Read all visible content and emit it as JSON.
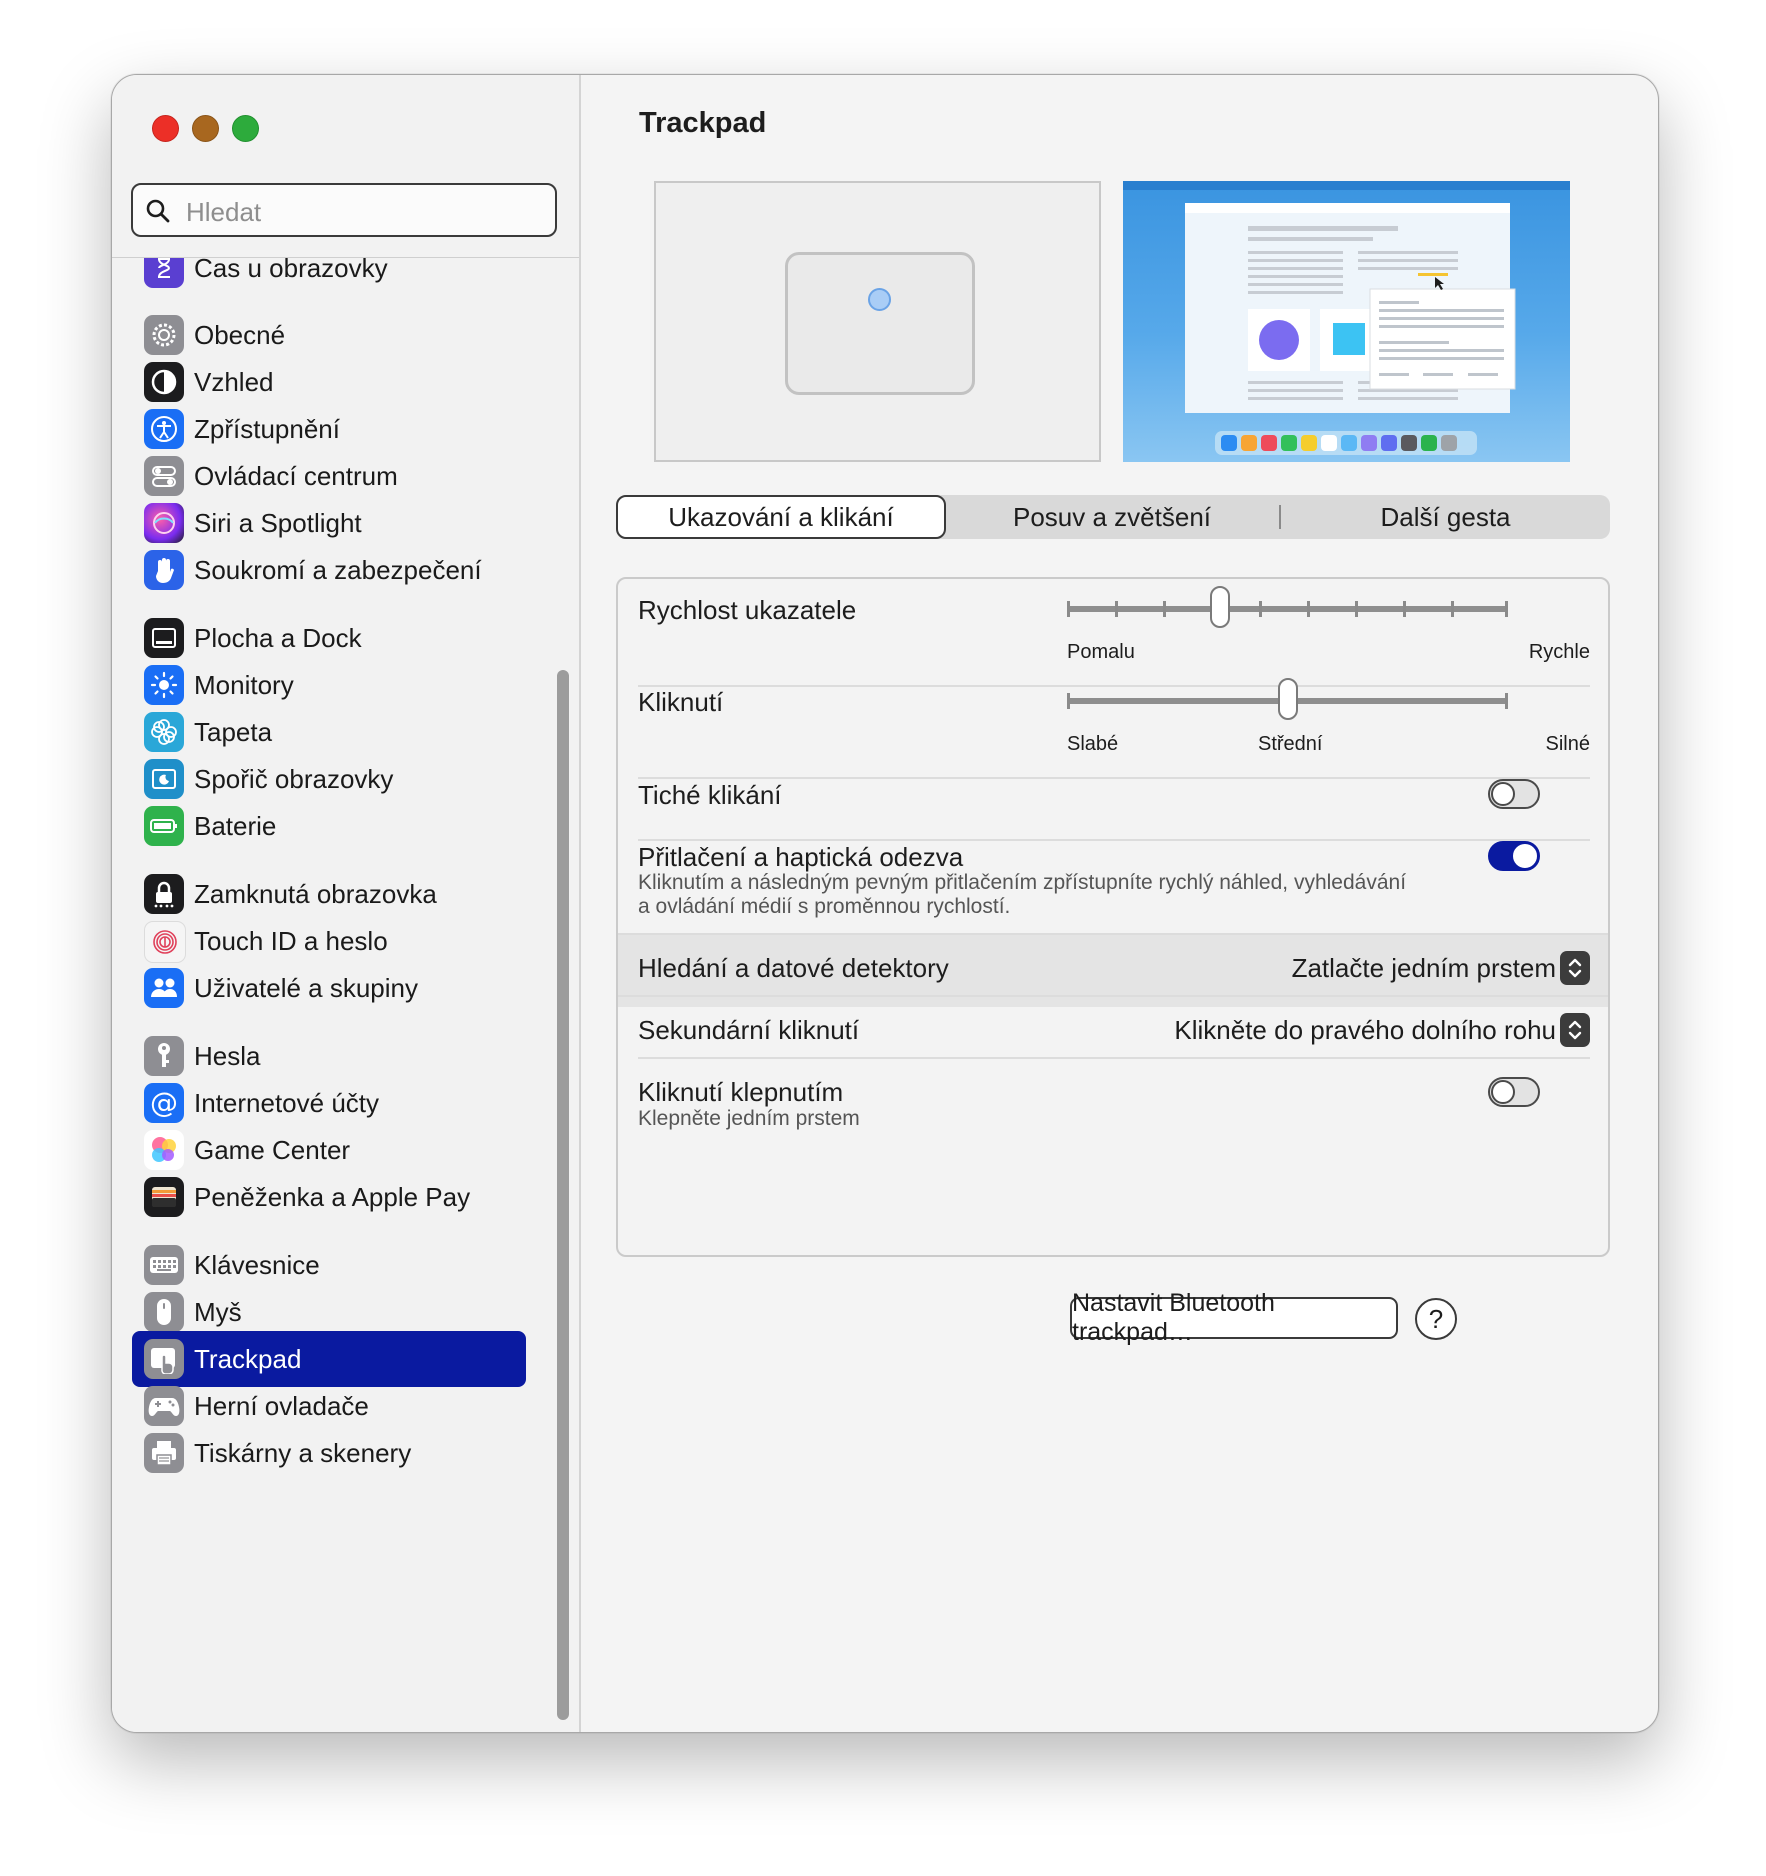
{
  "window": {
    "title": "Trackpad"
  },
  "search": {
    "placeholder": "Hledat"
  },
  "sidebar": {
    "items": [
      {
        "label": "Čas u obrazovky",
        "icon": "hourglass-icon",
        "color": "#5a3fd1"
      },
      {
        "label": "Obecné",
        "icon": "gear-icon",
        "color": "#8e8e93"
      },
      {
        "label": "Vzhled",
        "icon": "appearance-icon",
        "color": "#1c1c1e"
      },
      {
        "label": "Zpřístupnění",
        "icon": "accessibility-icon",
        "color": "#1a6ef5"
      },
      {
        "label": "Ovládací centrum",
        "icon": "control-center-icon",
        "color": "#8e8e93"
      },
      {
        "label": "Siri a Spotlight",
        "icon": "siri-icon",
        "color": "#c0208f"
      },
      {
        "label": "Soukromí a zabezpečení",
        "icon": "hand-icon",
        "color": "#2b63e8"
      },
      {
        "label": "Plocha a Dock",
        "icon": "dock-icon",
        "color": "#1c1c1e"
      },
      {
        "label": "Monitory",
        "icon": "brightness-icon",
        "color": "#1a6ef5"
      },
      {
        "label": "Tapeta",
        "icon": "flower-icon",
        "color": "#2aa7d8"
      },
      {
        "label": "Spořič obrazovky",
        "icon": "screensaver-icon",
        "color": "#1f8fc9"
      },
      {
        "label": "Baterie",
        "icon": "battery-icon",
        "color": "#2fb24c"
      },
      {
        "label": "Zamknutá obrazovka",
        "icon": "lock-icon",
        "color": "#1c1c1e"
      },
      {
        "label": "Touch ID a heslo",
        "icon": "fingerprint-icon",
        "color": "#f5f5f5"
      },
      {
        "label": "Uživatelé a skupiny",
        "icon": "users-icon",
        "color": "#1a6ef5"
      },
      {
        "label": "Hesla",
        "icon": "key-icon",
        "color": "#8e8e93"
      },
      {
        "label": "Internetové účty",
        "icon": "at-icon",
        "color": "#1a6ef5"
      },
      {
        "label": "Game Center",
        "icon": "game-center-icon",
        "color": "#ffffff"
      },
      {
        "label": "Peněženka a Apple Pay",
        "icon": "wallet-icon",
        "color": "#1c1c1e"
      },
      {
        "label": "Klávesnice",
        "icon": "keyboard-icon",
        "color": "#8e8e93"
      },
      {
        "label": "Myš",
        "icon": "mouse-icon",
        "color": "#8e8e93"
      },
      {
        "label": "Trackpad",
        "icon": "trackpad-icon",
        "color": "#8e8e93",
        "selected": true
      },
      {
        "label": "Herní ovladače",
        "icon": "gamepad-icon",
        "color": "#8e8e93"
      },
      {
        "label": "Tiskárny a skenery",
        "icon": "printer-icon",
        "color": "#8e8e93"
      }
    ]
  },
  "tabs": [
    {
      "label": "Ukazování a klikání",
      "selected": true
    },
    {
      "label": "Posuv a zvětšení",
      "selected": false
    },
    {
      "label": "Další gesta",
      "selected": false
    }
  ],
  "settings": {
    "pointer_speed": {
      "label": "Rychlost ukazatele",
      "min_label": "Pomalu",
      "max_label": "Rychle",
      "value": 0.34
    },
    "click": {
      "label": "Kliknutí",
      "labels": [
        "Slabé",
        "Střední",
        "Silné"
      ],
      "value": 0.5
    },
    "silent_click": {
      "label": "Tiché klikání",
      "on": false
    },
    "force_click": {
      "label": "Přitlačení a haptická odezva",
      "description_1": "Kliknutím a následným pevným přitlačením zpřístupníte rychlý náhled, vyhledávání",
      "description_2": "a ovládání médií s proměnnou rychlostí.",
      "on": true
    },
    "lookup": {
      "label": "Hledání a datové detektory",
      "value": "Zatlačte jedním prstem"
    },
    "secondary_click": {
      "label": "Sekundární kliknutí",
      "value": "Klikněte do pravého dolního rohu"
    },
    "tap_to_click": {
      "label": "Kliknutí klepnutím",
      "description": "Klepněte jedním prstem",
      "on": false
    }
  },
  "footer": {
    "bluetooth_button": "Nastavit Bluetooth trackpad…",
    "help_button": "?"
  },
  "colors": {
    "accent": "#0a1aa0",
    "traffic_red": "#ec2f27",
    "traffic_yellow": "#a8671f",
    "traffic_green": "#2dab3c"
  }
}
